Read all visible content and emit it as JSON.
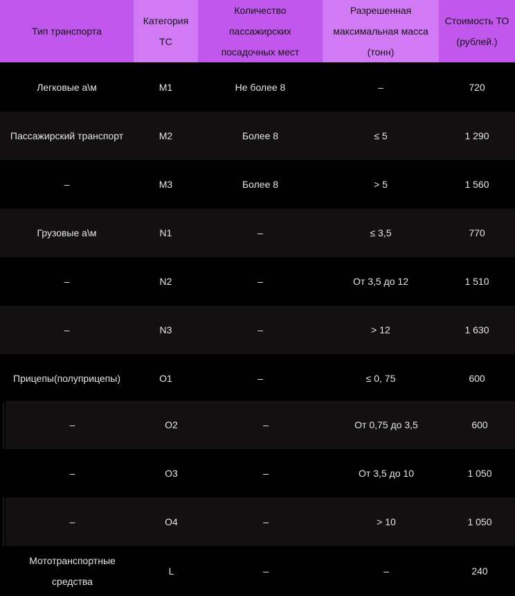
{
  "table": {
    "headers": [
      [
        "Тип транспорта"
      ],
      [
        "Категория",
        "ТС"
      ],
      [
        "Количество",
        "пассажирских",
        "посадочных мест"
      ],
      [
        "Разрешенная",
        "максимальная масса",
        "(тонн)"
      ],
      [
        "Стоимость ТО",
        "(рублей.)"
      ]
    ],
    "rows": [
      {
        "type": [
          "Легковые а\\м"
        ],
        "category": "М1",
        "seats": "Не более 8",
        "mass": "–",
        "cost": "720"
      },
      {
        "type": [
          "Пассажирский транспорт"
        ],
        "category": "М2",
        "seats": "Более 8",
        "mass": "≤ 5",
        "cost": "1 290"
      },
      {
        "type": [
          "–"
        ],
        "category": "М3",
        "seats": "Более 8",
        "mass": "> 5",
        "cost": "1 560"
      },
      {
        "type": [
          "Грузовые а\\м"
        ],
        "category": "N1",
        "seats": "–",
        "mass": "≤ 3,5",
        "cost": "770"
      },
      {
        "type": [
          "–"
        ],
        "category": "N2",
        "seats": "–",
        "mass": "От 3,5 до 12",
        "cost": "1 510"
      },
      {
        "type": [
          "–"
        ],
        "category": "N3",
        "seats": "–",
        "mass": "> 12",
        "cost": "1 630"
      },
      {
        "type": [
          "Прицепы(полуприцепы)"
        ],
        "category": "О1",
        "seats": "–",
        "mass": "≤ 0, 75",
        "cost": "600"
      },
      {
        "type": [
          "–"
        ],
        "category": "О2",
        "seats": "–",
        "mass": "От 0,75 до 3,5",
        "cost": "600"
      },
      {
        "type": [
          "–"
        ],
        "category": "О3",
        "seats": "–",
        "mass": "От 3,5 до 10",
        "cost": "1 050"
      },
      {
        "type": [
          "–"
        ],
        "category": "О4",
        "seats": "–",
        "mass": "> 10",
        "cost": "1 050"
      },
      {
        "type": [
          "Мототранспортные",
          "средства"
        ],
        "category": "L",
        "seats": "–",
        "mass": "–",
        "cost": "240"
      }
    ]
  },
  "colors": {
    "header_bg": "#c257ee",
    "header_alt_bg": "#d27af5",
    "row_dark": "#000000",
    "row_alt": "#121010",
    "text": "#e6e6e6"
  }
}
